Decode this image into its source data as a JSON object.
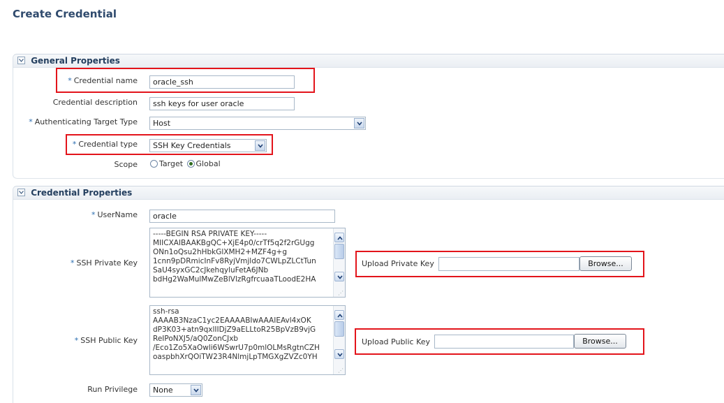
{
  "page": {
    "title": "Create Credential"
  },
  "general": {
    "header": "General Properties",
    "credential_name": {
      "label": "Credential name",
      "value": "oracle_ssh"
    },
    "credential_description": {
      "label": "Credential description",
      "value": "ssh keys for user oracle"
    },
    "authenticating_target_type": {
      "label": "Authenticating Target Type",
      "value": "Host"
    },
    "credential_type": {
      "label": "Credential type",
      "value": "SSH Key Credentials"
    },
    "scope": {
      "label": "Scope",
      "options": [
        "Target",
        "Global"
      ],
      "selected": "Global"
    }
  },
  "credential_props": {
    "header": "Credential Properties",
    "username": {
      "label": "UserName",
      "value": "oracle"
    },
    "private_key": {
      "label": "SSH Private Key",
      "lines": [
        "-----BEGIN RSA PRIVATE KEY-----",
        "MIICXAIBAAKBgQC+XjE4p0/crTf5q2f2rGUgg",
        "ONn1oQsu2hHbkGlXMH2+MZF4g+g",
        "1cnn9pDRmicInFv8RyjVmjldo7CWLpZLCtTun",
        "SaU4syxGC2cJkehqyluFetA6JNb",
        "bdHg2WaMulMwZeBlVlzRgfrcuaaTLoodE2HA"
      ],
      "upload_label": "Upload Private Key",
      "browse_label": "Browse..."
    },
    "public_key": {
      "label": "SSH Public Key",
      "lines": [
        "ssh-rsa",
        "AAAAB3NzaC1yc2EAAAABIwAAAIEAvl4xOK",
        "dP3K03+atn9qxlIIDjZ9aELLtoR25BpVzB9vjG",
        "ReIPoNXJ5/aQ0ZonCJxb",
        "/Eco1Zo5XaOwli6WSwrU7p0mlOLMsRgtnCZH",
        "oaspbhXrQOiTW23R4NlmjLpTMGXgZVZc0YH"
      ],
      "upload_label": "Upload Public Key",
      "browse_label": "Browse..."
    },
    "run_privilege": {
      "label": "Run Privilege",
      "value": "None"
    }
  },
  "colors": {
    "highlight": "#e3141b",
    "title": "#2f4a6d",
    "required_star": "#2a6db0"
  },
  "icons": {
    "collapse": "collapse-toggle-icon",
    "dropdown": "chevron-down-icon"
  }
}
